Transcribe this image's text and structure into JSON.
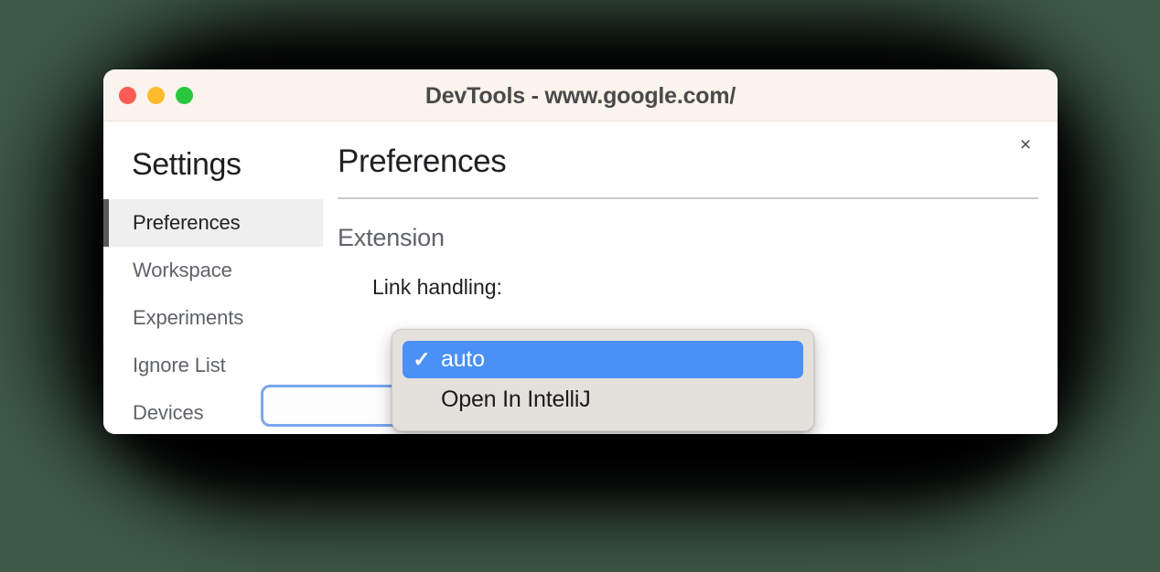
{
  "window": {
    "title": "DevTools - www.google.com/",
    "traffic_lights": [
      {
        "name": "close",
        "color": "#fc5c55"
      },
      {
        "name": "minimize",
        "color": "#febb2c"
      },
      {
        "name": "maximize",
        "color": "#29c73f"
      }
    ],
    "close_icon": "×"
  },
  "sidebar": {
    "title": "Settings",
    "items": [
      {
        "label": "Preferences",
        "selected": true
      },
      {
        "label": "Workspace",
        "selected": false
      },
      {
        "label": "Experiments",
        "selected": false
      },
      {
        "label": "Ignore List",
        "selected": false
      },
      {
        "label": "Devices",
        "selected": false
      }
    ]
  },
  "main": {
    "page_title": "Preferences",
    "section_title": "Extension",
    "field_label": "Link handling:"
  },
  "dropdown": {
    "open": true,
    "selected_value": "auto",
    "check_glyph": "✓",
    "options": [
      {
        "label": "auto",
        "selected": true
      },
      {
        "label": "Open In IntelliJ",
        "selected": false
      }
    ]
  },
  "colors": {
    "canvas": "#3f5a48",
    "titlebar": "#fbf4ee",
    "accent_blue": "#4a90f7",
    "focus_ring": "#7aa7ef",
    "popup_bg": "#e4e1dd",
    "selected_nav_bg": "#efefef",
    "selected_nav_bar": "#5a5a5a"
  }
}
